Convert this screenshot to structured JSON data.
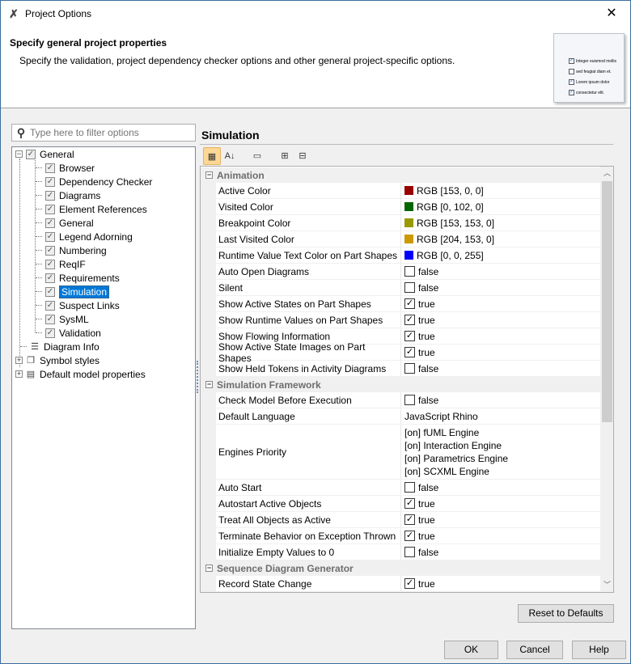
{
  "window": {
    "title": "Project Options",
    "close": "✕"
  },
  "header": {
    "title": "Specify general project properties",
    "description": "Specify the validation, project dependency checker options and other general project-specific options.",
    "illustration_lines": [
      "Integer euismod mollis",
      "sed feugiat diam et.",
      "Lorem ipsum dolor",
      "consectetur elit."
    ]
  },
  "filter": {
    "placeholder": "Type here to filter options"
  },
  "tree": {
    "general": "General",
    "children": [
      "Browser",
      "Dependency Checker",
      "Diagrams",
      "Element References",
      "General",
      "Legend Adorning",
      "Numbering",
      "ReqIF",
      "Requirements",
      "Simulation",
      "Suspect Links",
      "SysML",
      "Validation"
    ],
    "selected": "Simulation",
    "others": [
      "Diagram Info",
      "Symbol styles",
      "Default model properties"
    ]
  },
  "panel": {
    "title": "Simulation"
  },
  "grid": [
    {
      "group": "Animation"
    },
    {
      "name": "Active Color",
      "type": "color",
      "color": "#990000",
      "value": "RGB [153, 0, 0]"
    },
    {
      "name": "Visited Color",
      "type": "color",
      "color": "#006600",
      "value": "RGB [0, 102, 0]"
    },
    {
      "name": "Breakpoint Color",
      "type": "color",
      "color": "#999900",
      "value": "RGB [153, 153, 0]"
    },
    {
      "name": "Last Visited Color",
      "type": "color",
      "color": "#cc9900",
      "value": "RGB [204, 153, 0]"
    },
    {
      "name": "Runtime Value Text Color on Part Shapes",
      "type": "color",
      "color": "#0000ff",
      "value": "RGB [0, 0, 255]"
    },
    {
      "name": "Auto Open Diagrams",
      "type": "check",
      "checked": false,
      "value": "false"
    },
    {
      "name": "Silent",
      "type": "check",
      "checked": false,
      "value": "false"
    },
    {
      "name": "Show Active States on Part Shapes",
      "type": "check",
      "checked": true,
      "value": "true"
    },
    {
      "name": "Show Runtime Values on Part Shapes",
      "type": "check",
      "checked": true,
      "value": "true"
    },
    {
      "name": "Show Flowing Information",
      "type": "check",
      "checked": true,
      "value": "true"
    },
    {
      "name": "Show Active State Images on Part Shapes",
      "type": "check",
      "checked": true,
      "value": "true"
    },
    {
      "name": "Show Held Tokens in Activity Diagrams",
      "type": "check",
      "checked": false,
      "value": "false"
    },
    {
      "group": "Simulation Framework"
    },
    {
      "name": "Check Model Before Execution",
      "type": "check",
      "checked": false,
      "value": "false"
    },
    {
      "name": "Default Language",
      "type": "text",
      "value": "JavaScript Rhino"
    },
    {
      "name": "Engines Priority",
      "type": "list",
      "values": [
        "[on] fUML Engine",
        "[on] Interaction Engine",
        "[on] Parametrics Engine",
        "[on] SCXML Engine"
      ]
    },
    {
      "name": "Auto Start",
      "type": "check",
      "checked": false,
      "value": "false"
    },
    {
      "name": "Autostart Active Objects",
      "type": "check",
      "checked": true,
      "value": "true"
    },
    {
      "name": "Treat All Objects as Active",
      "type": "check",
      "checked": true,
      "value": "true"
    },
    {
      "name": "Terminate Behavior on Exception Thrown",
      "type": "check",
      "checked": true,
      "value": "true"
    },
    {
      "name": "Initialize Empty Values to 0",
      "type": "check",
      "checked": false,
      "value": "false"
    },
    {
      "group": "Sequence Diagram Generator"
    },
    {
      "name": "Record State Change",
      "type": "check",
      "checked": true,
      "value": "true"
    }
  ],
  "buttons": {
    "reset": "Reset to Defaults",
    "ok": "OK",
    "cancel": "Cancel",
    "help": "Help"
  }
}
